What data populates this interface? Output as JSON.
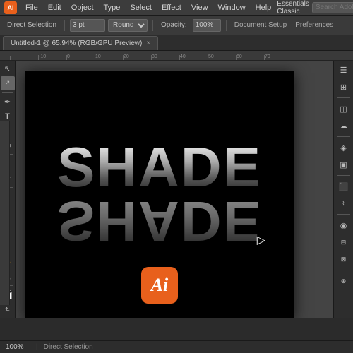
{
  "app": {
    "icon_label": "Ai",
    "title": "Adobe Illustrator"
  },
  "menu_bar": {
    "items": [
      "File",
      "Edit",
      "Object",
      "Type",
      "Select",
      "Effect",
      "View",
      "Window",
      "Help"
    ],
    "search_placeholder": "Search Adobe Stock",
    "workspace": "Essentials Classic"
  },
  "toolbar": {
    "tool_label": "Direct Selection",
    "stroke_size": "3 pt",
    "stroke_type": "Round",
    "opacity_label": "Opacity:",
    "opacity_value": "100%",
    "doc_setup_label": "Document Setup",
    "prefs_label": "Preferences"
  },
  "tab": {
    "title": "Untitled-1 @ 65.94% (RGB/GPU Preview)",
    "close_label": "×"
  },
  "canvas": {
    "zoom": "65%",
    "artboard_text_top": "SHADE",
    "artboard_text_bottom": "SHADE",
    "ai_icon_label": "Ai"
  },
  "left_tools": [
    {
      "name": "selection",
      "icon": "↖",
      "active": false
    },
    {
      "name": "direct-selection",
      "icon": "↖",
      "active": true
    },
    {
      "name": "pen",
      "icon": "✒"
    },
    {
      "name": "type",
      "icon": "T"
    },
    {
      "name": "line",
      "icon": "\\"
    },
    {
      "name": "rectangle",
      "icon": "□"
    },
    {
      "name": "paintbrush",
      "icon": "⌇"
    },
    {
      "name": "pencil",
      "icon": "✏"
    },
    {
      "name": "rotate",
      "icon": "↻"
    },
    {
      "name": "scale",
      "icon": "⤢"
    },
    {
      "name": "warp",
      "icon": "⌀"
    },
    {
      "name": "shape-builder",
      "icon": "⊕"
    },
    {
      "name": "eyedropper",
      "icon": "⊘"
    },
    {
      "name": "blend",
      "icon": "∞"
    },
    {
      "name": "graph",
      "icon": "▦"
    },
    {
      "name": "slice",
      "icon": "⊡"
    },
    {
      "name": "hand",
      "icon": "✋"
    },
    {
      "name": "zoom",
      "icon": "🔍"
    },
    {
      "name": "fill",
      "icon": "■"
    },
    {
      "name": "stroke",
      "icon": "□"
    }
  ],
  "right_tools": [
    {
      "name": "libraries",
      "icon": "☰"
    },
    {
      "name": "properties",
      "icon": "⊞"
    },
    {
      "name": "layers",
      "icon": "◫"
    },
    {
      "name": "cc-libraries",
      "icon": "☁"
    },
    {
      "name": "assets",
      "icon": "◈"
    },
    {
      "name": "artboards",
      "icon": "▣"
    },
    {
      "name": "swatches",
      "icon": "⬛"
    },
    {
      "name": "brushes",
      "icon": "⌇"
    },
    {
      "name": "symbols",
      "icon": "⊛"
    },
    {
      "name": "appearance",
      "icon": "◉"
    },
    {
      "name": "align",
      "icon": "⊟"
    },
    {
      "name": "transform",
      "icon": "⊠"
    },
    {
      "name": "pathfinder",
      "icon": "⊕"
    }
  ],
  "status_bar": {
    "zoom": "100%",
    "info": "Direct Selection"
  },
  "colors": {
    "bg_dark": "#2b2b2b",
    "bg_medium": "#3a3a3a",
    "bg_light": "#444444",
    "accent_orange": "#e8601c",
    "text_primary": "#cccccc",
    "artboard_bg": "#000000"
  }
}
